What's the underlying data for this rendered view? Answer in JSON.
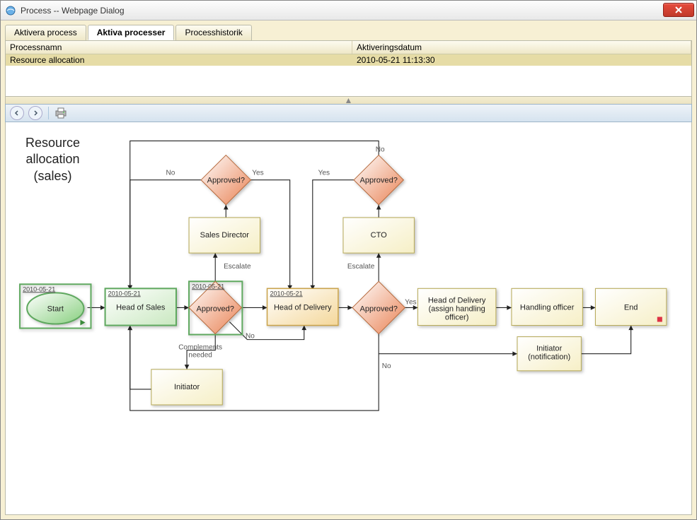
{
  "window": {
    "title": "Process -- Webpage Dialog"
  },
  "tabs": {
    "activate": "Aktivera process",
    "active": "Aktiva processer",
    "history": "Processhistorik"
  },
  "grid": {
    "col_name": "Processnamn",
    "col_date": "Aktiveringsdatum",
    "row_name": "Resource allocation",
    "row_date": "2010-05-21 11:13:30"
  },
  "diagram": {
    "title_l1": "Resource",
    "title_l2": "allocation",
    "title_l3": "(sales)",
    "start": "Start",
    "head_of_sales": "Head of Sales",
    "approved": "Approved?",
    "sales_director": "Sales Director",
    "head_of_delivery": "Head of Delivery",
    "cto": "CTO",
    "hod_assign_l1": "Head of Delivery",
    "hod_assign_l2": "(assign handling",
    "hod_assign_l3": "officer)",
    "handling_officer": "Handling officer",
    "end": "End",
    "initiator": "Initiator",
    "initiator_notif_l1": "Initiator",
    "initiator_notif_l2": "(notification)",
    "yes": "Yes",
    "no": "No",
    "escalate": "Escalate",
    "complements_l1": "Complements",
    "complements_l2": "needed",
    "date": "2010-05-21"
  }
}
